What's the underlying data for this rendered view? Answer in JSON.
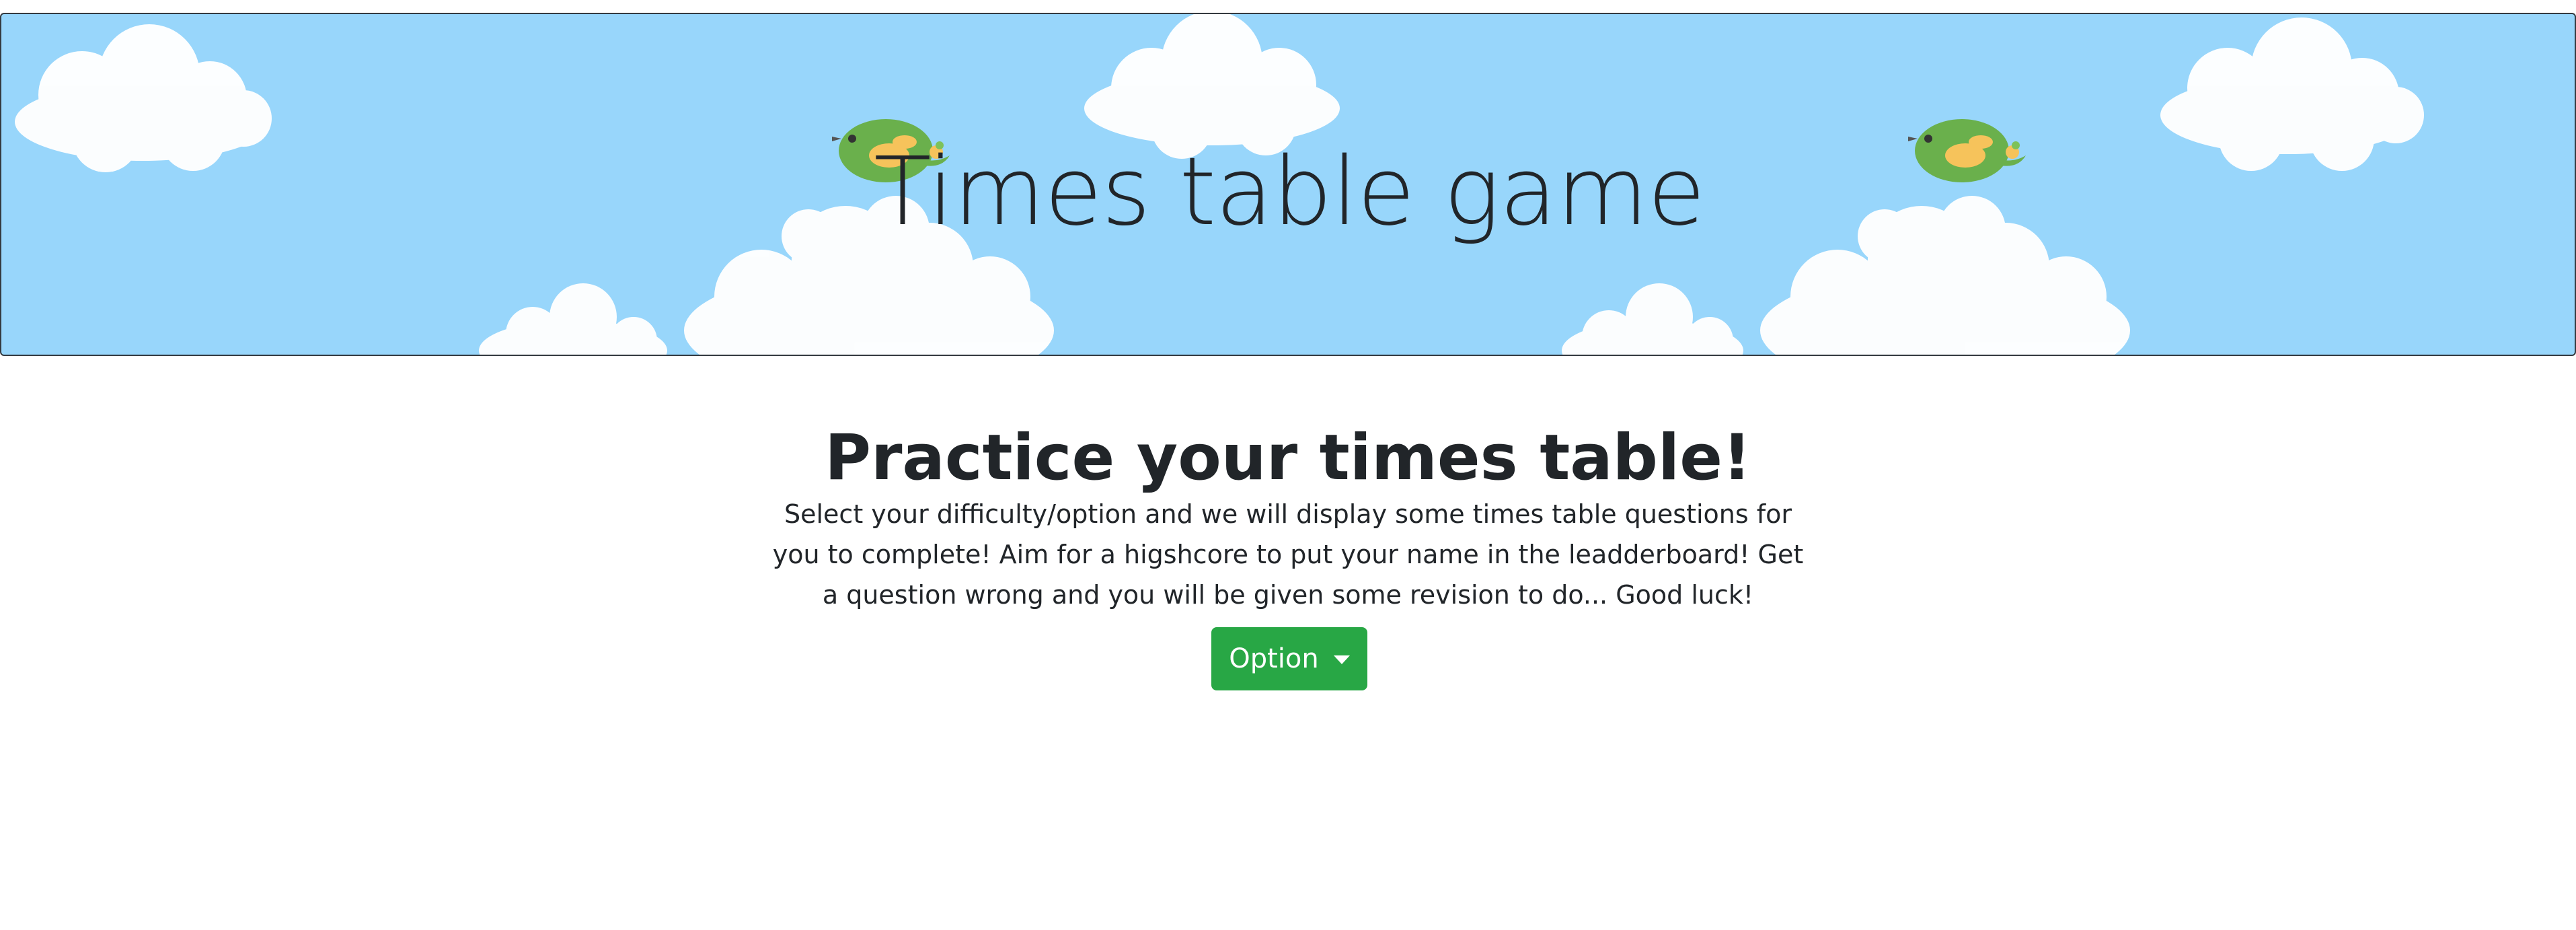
{
  "banner": {
    "title": "Times table game",
    "background_color": "#98d6fb",
    "decorations": [
      "cloud-icon",
      "bird-icon"
    ]
  },
  "main": {
    "heading": "Practice your times table!",
    "intro": "Select your difficulty/option and we will display some times table questions for you to complete! Aim for a higshcore to put your name in the leadderboard! Get a question wrong and you will be given some revision to do... Good luck!",
    "option_button": {
      "label": "Option",
      "color": "#28a745",
      "icon": "caret-down-icon"
    }
  }
}
